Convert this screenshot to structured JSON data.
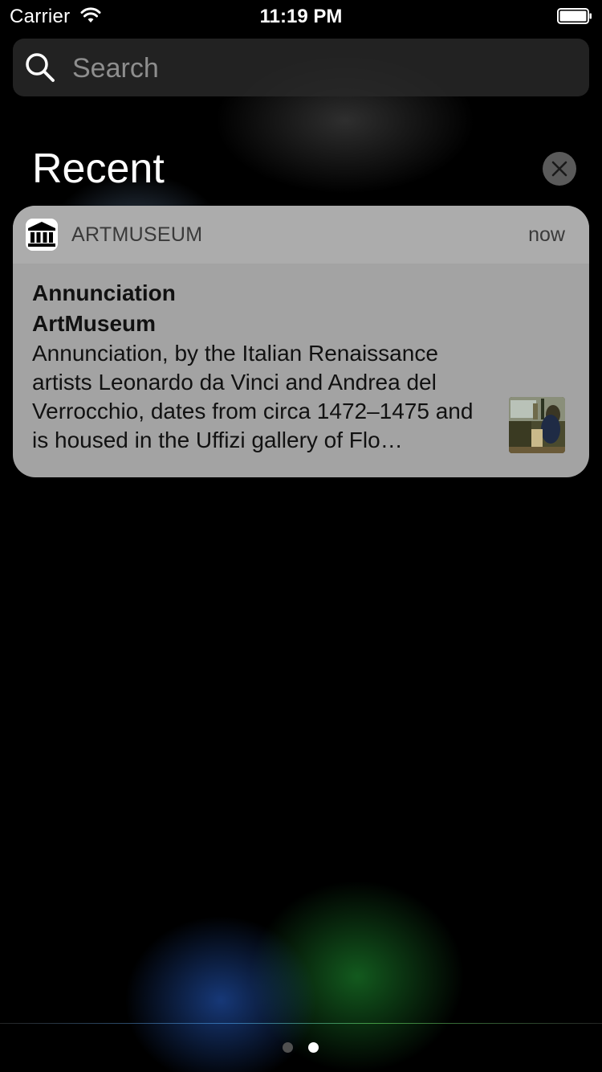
{
  "status_bar": {
    "carrier": "Carrier",
    "time": "11:19 PM",
    "icons": [
      "wifi-icon",
      "battery-icon"
    ]
  },
  "search": {
    "placeholder": "Search",
    "value": "",
    "icon": "search-icon"
  },
  "recent": {
    "title": "Recent",
    "clear_icon": "close-icon"
  },
  "notification": {
    "app_icon": "museum-icon",
    "app_name": "ARTMUSEUM",
    "time": "now",
    "title": "Annunciation",
    "subtitle": "ArtMuseum",
    "message": "Annunciation, by the Italian Renaissance artists Leonardo da Vinci and Andrea del Verrocchio, dates from circa 1472–1475 and is housed in the Uffizi gallery of Flo…",
    "thumbnail": "painting-thumbnail"
  },
  "page_control": {
    "pages": 2,
    "current": 2
  },
  "colors": {
    "card_header": "#acacac",
    "card_body": "#a3a3a3",
    "search_bg": "#282828",
    "clear_button": "#5a5a5a"
  }
}
